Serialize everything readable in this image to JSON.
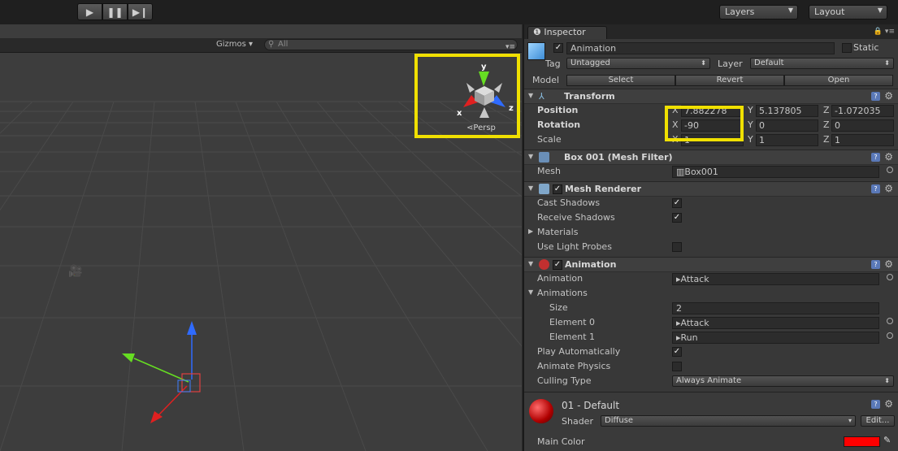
{
  "toolbar": {
    "play_icon": "play-icon",
    "pause_icon": "pause-icon",
    "step_icon": "step-icon",
    "layers_label": "Layers",
    "layout_label": "Layout"
  },
  "scene": {
    "gizmos_label": "Gizmos",
    "search_placeholder": "All",
    "orientation": {
      "y_label": "y",
      "x_label": "x",
      "z_label": "z",
      "projection_label": "Persp"
    }
  },
  "inspector": {
    "tab_label": "Inspector",
    "object_name": "Animation",
    "static_label": "Static",
    "tag_label": "Tag",
    "tag_value": "Untagged",
    "layer_label": "Layer",
    "layer_value": "Default",
    "model_label": "Model",
    "model_buttons": [
      "Select",
      "Revert",
      "Open"
    ],
    "transform": {
      "title": "Transform",
      "position_label": "Position",
      "position": {
        "x": "7.882278",
        "y": "5.137805",
        "z": "-1.072035"
      },
      "rotation_label": "Rotation",
      "rotation": {
        "x": "-90",
        "y": "0",
        "z": "0"
      },
      "scale_label": "Scale",
      "scale": {
        "x": "1",
        "y": "1",
        "z": "1"
      }
    },
    "mesh_filter": {
      "title": "Box 001 (Mesh Filter)",
      "mesh_label": "Mesh",
      "mesh_value": "Box001"
    },
    "mesh_renderer": {
      "title": "Mesh Renderer",
      "cast_shadows_label": "Cast Shadows",
      "cast_shadows": true,
      "receive_shadows_label": "Receive Shadows",
      "receive_shadows": true,
      "materials_label": "Materials",
      "use_light_probes_label": "Use Light Probes",
      "use_light_probes": false
    },
    "animation": {
      "title": "Animation",
      "animation_label": "Animation",
      "animation_value": "Attack",
      "animations_label": "Animations",
      "size_label": "Size",
      "size_value": "2",
      "element0_label": "Element 0",
      "element0_value": "Attack",
      "element1_label": "Element 1",
      "element1_value": "Run",
      "play_auto_label": "Play Automatically",
      "play_auto": true,
      "animate_physics_label": "Animate Physics",
      "animate_physics": false,
      "culling_label": "Culling Type",
      "culling_value": "Always Animate"
    },
    "material": {
      "name": "01 - Default",
      "shader_label": "Shader",
      "shader_value": "Diffuse",
      "edit_label": "Edit...",
      "main_color_label": "Main Color",
      "main_color": "#ff0000"
    }
  }
}
